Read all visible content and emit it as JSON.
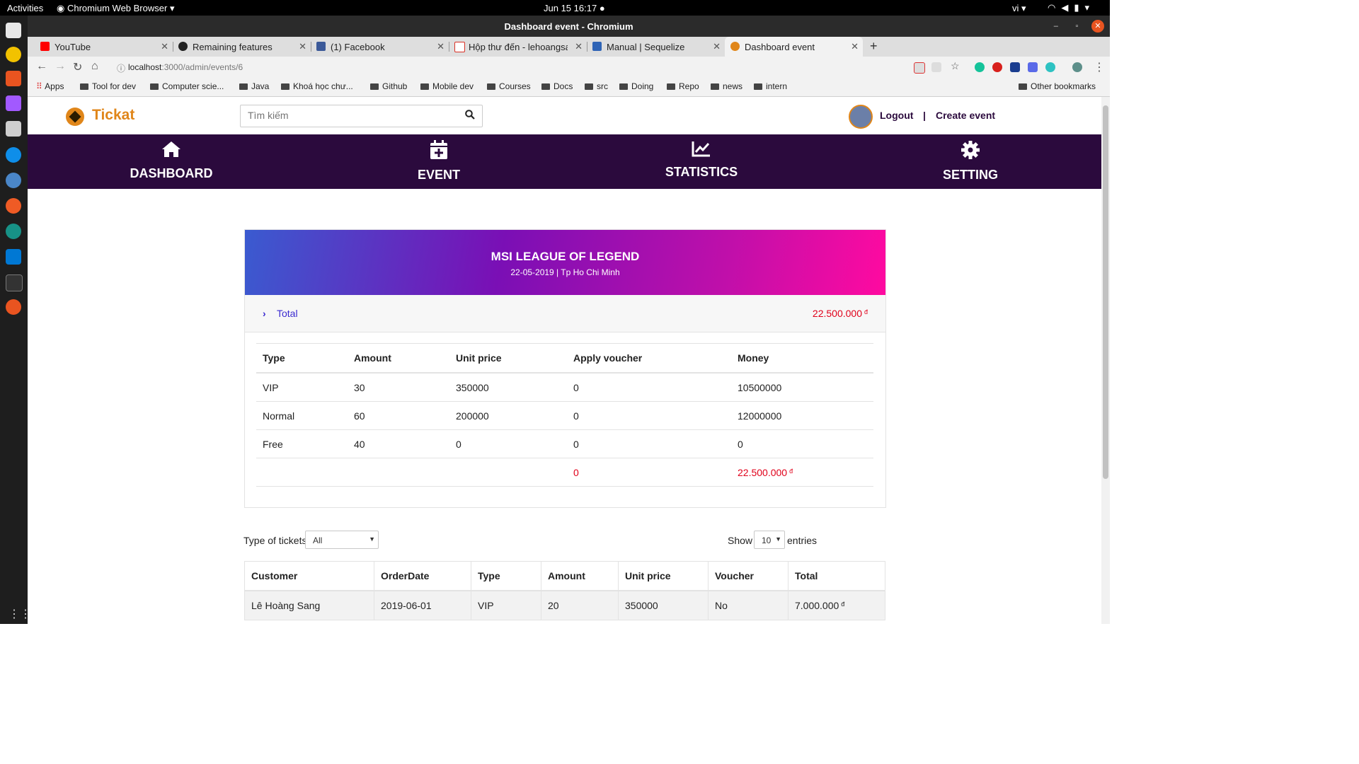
{
  "os": {
    "activities": "Activities",
    "app_menu": "Chromium Web Browser",
    "clock": "Jun 15  16:17",
    "lang": "vi"
  },
  "window": {
    "title": "Dashboard event - Chromium"
  },
  "tabs": [
    {
      "label": "YouTube",
      "icon": "youtube-icon",
      "color": "#ff0000"
    },
    {
      "label": "Remaining features",
      "icon": "github-icon",
      "color": "#222222"
    },
    {
      "label": "(1) Facebook",
      "icon": "facebook-icon",
      "color": "#3b5998"
    },
    {
      "label": "Hộp thư đến - lehoangsan",
      "icon": "gmail-icon",
      "color": "#d93025"
    },
    {
      "label": "Manual | Sequelize",
      "icon": "sequelize-icon",
      "color": "#2f64b6"
    },
    {
      "label": "Dashboard event",
      "icon": "tickat-icon",
      "color": "#e0861a"
    }
  ],
  "address": {
    "host": "localhost",
    "rest": ":3000/admin/events/6"
  },
  "bookmarks": [
    "Apps",
    "Tool for dev",
    "Computer scie...",
    "Java",
    "Khoá học chư...",
    "Github",
    "Mobile dev",
    "Courses",
    "Docs",
    "src",
    "Doing",
    "Repo",
    "news",
    "intern",
    "Other bookmarks"
  ],
  "site": {
    "brand": "Tickat",
    "search_placeholder": "Tìm kiếm",
    "logout": "Logout",
    "divider": "|",
    "create_event": "Create event",
    "nav": [
      "DASHBOARD",
      "EVENT",
      "STATISTICS",
      "SETTING"
    ]
  },
  "event": {
    "name": "MSI LEAGUE OF LEGEND",
    "meta": "22-05-2019 | Tp Ho Chi Minh",
    "total_label": "Total",
    "total_value": "22.500.000",
    "currency": "đ"
  },
  "summary": {
    "headers": [
      "Type",
      "Amount",
      "Unit price",
      "Apply voucher",
      "Money"
    ],
    "rows": [
      [
        "VIP",
        "30",
        "350000",
        "0",
        "10500000"
      ],
      [
        "Normal",
        "60",
        "200000",
        "0",
        "12000000"
      ],
      [
        "Free",
        "40",
        "0",
        "0",
        "0"
      ]
    ],
    "footer": {
      "voucher_total": "0",
      "money_total": "22.500.000"
    }
  },
  "filters": {
    "type_label": "Type of tickets",
    "type_value": "All",
    "show_label": "Show",
    "show_value": "10",
    "entries_label": "entries"
  },
  "orders": {
    "headers": [
      "Customer",
      "OrderDate",
      "Type",
      "Amount",
      "Unit price",
      "Voucher",
      "Total"
    ],
    "rows": [
      [
        "Lê Hoàng Sang",
        "2019-06-01",
        "VIP",
        "20",
        "350000",
        "No",
        "7.000.000"
      ]
    ]
  }
}
